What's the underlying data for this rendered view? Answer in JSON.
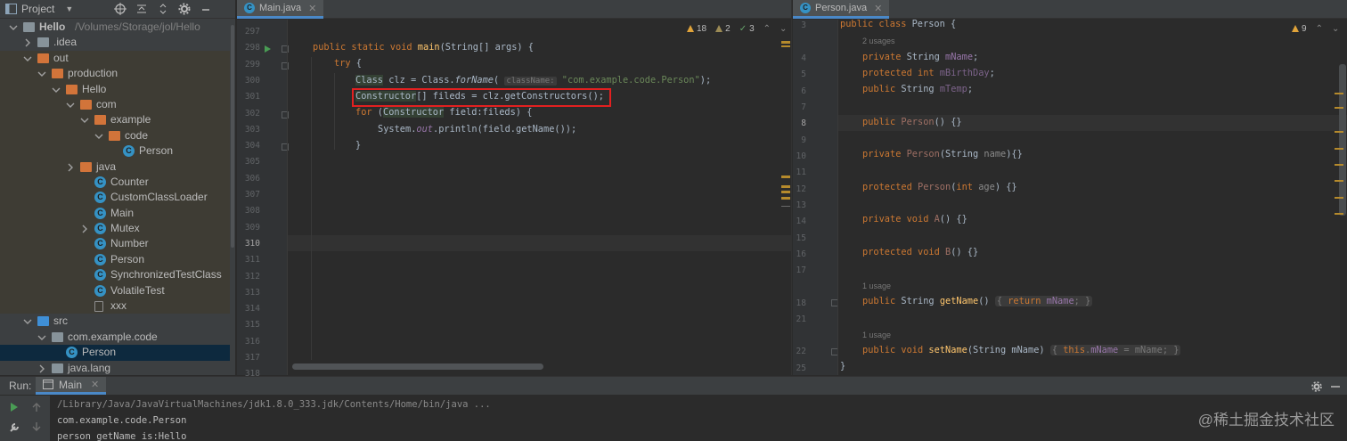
{
  "project_panel": {
    "title": "Project",
    "tree": [
      {
        "label": "Hello",
        "path": "/Volumes/Storage/jol/Hello",
        "type": "folder",
        "indent": 0,
        "expanded": true
      },
      {
        "label": ".idea",
        "type": "folder",
        "indent": 1,
        "expanded": false
      },
      {
        "label": "out",
        "type": "folder-orange",
        "indent": 1,
        "expanded": true,
        "highlight": true
      },
      {
        "label": "production",
        "type": "folder-orange",
        "indent": 2,
        "expanded": true,
        "highlight": true
      },
      {
        "label": "Hello",
        "type": "folder-orange",
        "indent": 3,
        "expanded": true,
        "highlight": true
      },
      {
        "label": "com",
        "type": "folder-orange",
        "indent": 4,
        "expanded": true,
        "highlight": true
      },
      {
        "label": "example",
        "type": "folder-orange",
        "indent": 5,
        "expanded": true,
        "highlight": true
      },
      {
        "label": "code",
        "type": "folder-orange",
        "indent": 6,
        "expanded": true,
        "highlight": true
      },
      {
        "label": "Person",
        "type": "class",
        "indent": 7,
        "highlight": true
      },
      {
        "label": "java",
        "type": "folder-orange",
        "indent": 4,
        "expanded": false,
        "highlight": true
      },
      {
        "label": "Counter",
        "type": "class",
        "indent": 5,
        "highlight": true
      },
      {
        "label": "CustomClassLoader",
        "type": "class",
        "indent": 5,
        "highlight": true
      },
      {
        "label": "Main",
        "type": "class",
        "indent": 5,
        "highlight": true
      },
      {
        "label": "Mutex",
        "type": "class",
        "indent": 5,
        "expandable": true,
        "highlight": true
      },
      {
        "label": "Number",
        "type": "class",
        "indent": 5,
        "highlight": true
      },
      {
        "label": "Person",
        "type": "class",
        "indent": 5,
        "highlight": true
      },
      {
        "label": "SynchronizedTestClass",
        "type": "class",
        "indent": 5,
        "highlight": true
      },
      {
        "label": "VolatileTest",
        "type": "class",
        "indent": 5,
        "highlight": true
      },
      {
        "label": "xxx",
        "type": "file",
        "indent": 5,
        "highlight": true
      },
      {
        "label": "src",
        "type": "folder-blue",
        "indent": 1,
        "expanded": true
      },
      {
        "label": "com.example.code",
        "type": "folder",
        "indent": 2,
        "expanded": true
      },
      {
        "label": "Person",
        "type": "class",
        "indent": 3,
        "selected": true
      },
      {
        "label": "java.lang",
        "type": "folder",
        "indent": 2,
        "expanded": false
      }
    ]
  },
  "left_editor": {
    "tab": "Main.java",
    "inspections": {
      "warnings": "18",
      "weak": "2",
      "typos": "3"
    },
    "line_numbers": [
      "297",
      "298",
      "299",
      "300",
      "301",
      "302",
      "303",
      "304",
      "305",
      "306",
      "307",
      "308",
      "309",
      "310",
      "311",
      "312",
      "313",
      "314",
      "315",
      "316",
      "317",
      "318"
    ],
    "current_line": "310",
    "code": {
      "l298_kw": "public static void ",
      "l298_fn": "main",
      "l298_rest": "(String[] args) {",
      "l299_kw": "try",
      "l299_rest": " {",
      "l300_cls": "Class",
      "l300_a": " clz = Class.",
      "l300_fn": "forName",
      "l300_b": "( ",
      "l300_hint": "className:",
      "l300_str": " \"com.example.code.Person\"",
      "l300_end": ");",
      "l301_cls": "Constructor",
      "l301_rest": "[] fileds = clz.getConstructors();",
      "l302_kw": "for",
      "l302_a": " (",
      "l302_cls": "Constructor",
      "l302_rest": " field:fileds) {",
      "l303_a": "System.",
      "l303_out": "out",
      "l303_b": ".println(field.getName());",
      "l304": "}"
    }
  },
  "right_editor": {
    "tab": "Person.java",
    "warnings": "9",
    "line_numbers": [
      "3",
      "4",
      "5",
      "6",
      "7",
      "8",
      "9",
      "10",
      "11",
      "12",
      "13",
      "14",
      "15",
      "16",
      "17",
      "18",
      "21",
      "22",
      "25"
    ],
    "current_line": "8",
    "code": {
      "c_kw": "public class ",
      "c_name": "Person {",
      "usage2": "2 usages",
      "f1_kw": "private ",
      "f1_t": "String ",
      "f1_n": "mName",
      "f2_kw": "protected int ",
      "f2_n": "mBirthDay",
      "f3_kw": "public ",
      "f3_t": "String ",
      "f3_n": "mTemp",
      "semi": ";",
      "k1_kw": "public ",
      "k1_n": "Person",
      "k1_r": "() {}",
      "k2_kw": "private ",
      "k2_n": "Person",
      "k2_a": "(String ",
      "k2_p": "name",
      "k2_r": "){}",
      "k3_kw": "protected ",
      "k3_n": "Person",
      "k3_a": "(",
      "k3_int": "int ",
      "k3_p": "age",
      "k3_r": ") {}",
      "m1_kw": "private void ",
      "m1_n": "A",
      "m1_r": "() {}",
      "m2_kw": "protected void ",
      "m2_n": "B",
      "m2_r": "() {}",
      "usage1a": "1 usage",
      "g_kw": "public ",
      "g_t": "String ",
      "g_n": "getName",
      "g_a": "() ",
      "g_inl_kw": "return ",
      "g_inl_f": "mName",
      "g_inl_e": "; ",
      "usage1b": "1 usage",
      "s_kw": "public void ",
      "s_n": "setName",
      "s_a": "(String mName) ",
      "s_this": "this",
      "s_dot": ".",
      "s_f": "mName",
      "s_e": " = mName; ",
      "brace_open": "{",
      "brace_close": "}",
      "close": "}"
    }
  },
  "run_panel": {
    "label": "Run:",
    "tab": "Main",
    "lines": [
      "/Library/Java/JavaVirtualMachines/jdk1.8.0_333.jdk/Contents/Home/bin/java ...",
      "com.example.code.Person",
      "person getName is:Hello"
    ]
  },
  "watermark": "@稀土掘金技术社区",
  "colors": {
    "accent": "#4a88c7",
    "highlight_box": "#e32020",
    "keyword": "#cc7832",
    "method": "#ffc66d",
    "string": "#6a8759",
    "field": "#9876aa"
  }
}
